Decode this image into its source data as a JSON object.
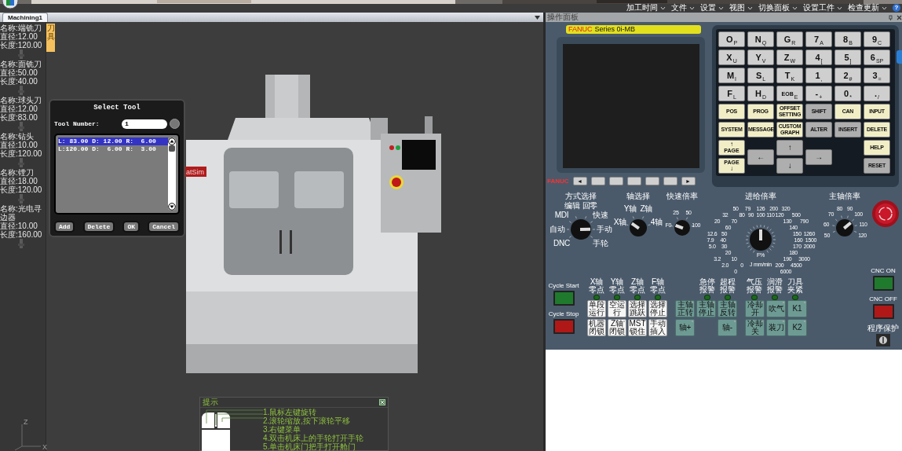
{
  "menu_bar": {
    "items": [
      "加工时间",
      "文件",
      "设置",
      "视图",
      "切换面板",
      "设置工件",
      "检查更新"
    ],
    "help": "?"
  },
  "document_tabs": [
    {
      "label": "Machining1",
      "selected": true
    }
  ],
  "panel_header": {
    "title": "操作面板"
  },
  "tool_library": {
    "tab": "刀具",
    "tools": [
      {
        "name": "名称:端铣刀",
        "diameter": "直径:12.00",
        "length": "长度:120.00"
      },
      {
        "name": "名称:面铣刀",
        "diameter": "直径:50.00",
        "length": "长度:40.00"
      },
      {
        "name": "名称:球头刀",
        "diameter": "直径:12.00",
        "length": "长度:83.00"
      },
      {
        "name": "名称:钻头",
        "diameter": "直径:10.00",
        "length": "长度:120.00"
      },
      {
        "name": "名称:镗刀",
        "diameter": "直径:18.00",
        "length": "长度:120.00"
      },
      {
        "name": "名称:光电寻边器",
        "diameter": "直径:10.00",
        "length": "长度:160.00"
      }
    ]
  },
  "select_tool_dialog": {
    "title": "Select Tool",
    "number_label": "Tool Number:",
    "number_value": "1",
    "rows": [
      {
        "text": "L: 83.00 D: 12.00 R:  6.00",
        "selected": true
      },
      {
        "text": "L:120.00 D:  6.00 R:  3.00",
        "selected": false
      }
    ],
    "buttons": [
      "Add",
      "Delete",
      "OK",
      "Cancel"
    ]
  },
  "machine_view": {
    "label": "atSim",
    "axes": [
      "Z",
      "X"
    ]
  },
  "hints": {
    "title": "提示",
    "lines": [
      "1.鼠标左键旋转",
      "2.滚轮缩放,按下滚轮平移",
      "3.右键菜单",
      "4.双击机床上的手轮打开手轮",
      "5.单击机床门把手打开舱门"
    ]
  },
  "cnc": {
    "brand": "FANUC",
    "model": "Series 0i-MB",
    "softkey_brand": "FANUC",
    "softkeys": [
      {
        "kind": "left",
        "label": "◄"
      },
      {
        "kind": "blank"
      },
      {
        "kind": "blank"
      },
      {
        "kind": "blank"
      },
      {
        "kind": "blank"
      },
      {
        "kind": "blank"
      },
      {
        "kind": "right",
        "label": "►"
      }
    ],
    "keys": [
      {
        "kind": "char",
        "main": "O",
        "sub": "P"
      },
      {
        "kind": "char",
        "main": "N",
        "sub": "Q"
      },
      {
        "kind": "char",
        "main": "G",
        "sub": "R"
      },
      {
        "kind": "char",
        "main": "7",
        "sub": "A"
      },
      {
        "kind": "char",
        "main": "8",
        "sub": "B"
      },
      {
        "kind": "char",
        "main": "9",
        "sub": "C"
      },
      {
        "kind": "char",
        "main": "X",
        "sub": "U"
      },
      {
        "kind": "char",
        "main": "Y",
        "sub": "V"
      },
      {
        "kind": "char",
        "main": "Z",
        "sub": "W"
      },
      {
        "kind": "char",
        "main": "4",
        "sub": "["
      },
      {
        "kind": "char",
        "main": "5",
        "sub": "]"
      },
      {
        "kind": "char",
        "main": "6",
        "sub": "SP"
      },
      {
        "kind": "char",
        "main": "M",
        "sub": "I"
      },
      {
        "kind": "char",
        "main": "S",
        "sub": "L"
      },
      {
        "kind": "char",
        "main": "T",
        "sub": "K"
      },
      {
        "kind": "char",
        "main": "1",
        "sub": ","
      },
      {
        "kind": "char",
        "main": "2",
        "sub": "#"
      },
      {
        "kind": "char",
        "main": "3",
        "sub": "="
      },
      {
        "kind": "char",
        "main": "F",
        "sub": "L"
      },
      {
        "kind": "char",
        "main": "H",
        "sub": "D"
      },
      {
        "kind": "char",
        "main": "EOB",
        "sub": "E"
      },
      {
        "kind": "char",
        "main": "-",
        "sub": "+"
      },
      {
        "kind": "char",
        "main": "0",
        "sub": "*"
      },
      {
        "kind": "char",
        "main": ".",
        "sub": "/"
      },
      {
        "kind": "function",
        "label": "POS"
      },
      {
        "kind": "function",
        "label": "PROG"
      },
      {
        "kind": "function",
        "label": "OFFSET\nSETTING"
      },
      {
        "kind": "gray",
        "label": "SHIFT"
      },
      {
        "kind": "function",
        "label": "CAN"
      },
      {
        "kind": "function",
        "label": "INPUT"
      },
      {
        "kind": "function",
        "label": "SYSTEM"
      },
      {
        "kind": "function",
        "label": "MESSAGE"
      },
      {
        "kind": "function",
        "label": "CUSTOM\nGRAPH"
      },
      {
        "kind": "gray",
        "label": "ALTER"
      },
      {
        "kind": "gray",
        "label": "INSERT"
      },
      {
        "kind": "function",
        "label": "DELETE"
      }
    ],
    "nav_keys": [
      {
        "kind": "page-up",
        "label": "PAGE",
        "arrow": "↑"
      },
      {
        "kind": "page-down",
        "label": "PAGE",
        "arrow": "↓"
      },
      {
        "kind": "gray",
        "label": "←"
      },
      {
        "kind": "gray",
        "label": "↑"
      },
      {
        "kind": "gray",
        "label": "↓"
      },
      {
        "kind": "gray",
        "label": "→"
      },
      {
        "kind": "function",
        "label": "HELP"
      },
      {
        "kind": "gray",
        "label": "RESET"
      }
    ]
  },
  "lower_panel": {
    "dials": [
      {
        "kind": "mode",
        "title": "方式选择",
        "labels": [
          "编辑",
          "回零",
          "MDI",
          "快速",
          "自动",
          "手动",
          "DNC",
          "手轮"
        ]
      },
      {
        "kind": "axis",
        "title": "轴选择",
        "labels": [
          "Y轴",
          "Z轴",
          "X轴",
          "4轴"
        ]
      },
      {
        "kind": "rapid",
        "title": "快速倍率",
        "labels": [
          "25",
          "50",
          "F0",
          "100"
        ]
      },
      {
        "kind": "feed",
        "title": "进给倍率",
        "labels": [
          "50",
          "79",
          "126",
          "200",
          "320",
          "32",
          "500",
          "20",
          "790",
          "12.6",
          "1260",
          "7.9",
          "1500",
          "5.0",
          "2000",
          "3.2",
          "3000",
          "2.0",
          "4500",
          "0",
          "6000"
        ],
        "inner_labels": [
          "80",
          "90",
          "100",
          "110",
          "120",
          "70",
          "130",
          "60",
          "140",
          "50",
          "150",
          "40",
          "160",
          "30",
          "170",
          "20",
          "180",
          "10",
          "190",
          "0",
          "200"
        ],
        "unit_labels": [
          "F%",
          "J mm/min"
        ]
      },
      {
        "kind": "spindle",
        "title": "主轴倍率",
        "labels": [
          "80",
          "90",
          "70",
          "100",
          "60",
          "110",
          "50",
          "120"
        ]
      }
    ],
    "cycle": {
      "start": "Cycle Start",
      "stop": "Cycle Stop"
    },
    "mode_group": {
      "leds": [
        "X轴零点",
        "Y轴零点",
        "Z轴零点",
        "F轴零点"
      ],
      "buttons": [
        "单段运行",
        "空运行",
        "选择跳跃",
        "选择停止",
        "机器闭锁",
        "Z轴闭锁",
        "MST锁住",
        "手动插入"
      ]
    },
    "spindle_group": {
      "leds": [
        "急停报警",
        "超程报警"
      ],
      "buttons": [
        {
          "kind": "labeled",
          "label": "主轴正转"
        },
        {
          "kind": "labeled",
          "label": "主轴停止"
        },
        {
          "kind": "labeled",
          "label": "主轴反转"
        },
        {
          "kind": "labeled",
          "label": "轴+"
        },
        {
          "kind": "blank"
        },
        {
          "kind": "labeled",
          "label": "轴-"
        }
      ]
    },
    "coolant_group": {
      "leds": [
        "气压报警",
        "润滑报警",
        "刀具夹紧"
      ],
      "buttons": [
        {
          "kind": "labeled",
          "label": "冷却开"
        },
        {
          "kind": "labeled",
          "label": "吹气"
        },
        {
          "kind": "labeled",
          "label": "K1"
        },
        {
          "kind": "labeled",
          "label": "冷却关"
        },
        {
          "kind": "labeled",
          "label": "装刀"
        },
        {
          "kind": "labeled",
          "label": "K2"
        }
      ]
    },
    "power": {
      "on": "CNC ON",
      "off": "CNC OFF",
      "protect": "程序保护"
    }
  }
}
